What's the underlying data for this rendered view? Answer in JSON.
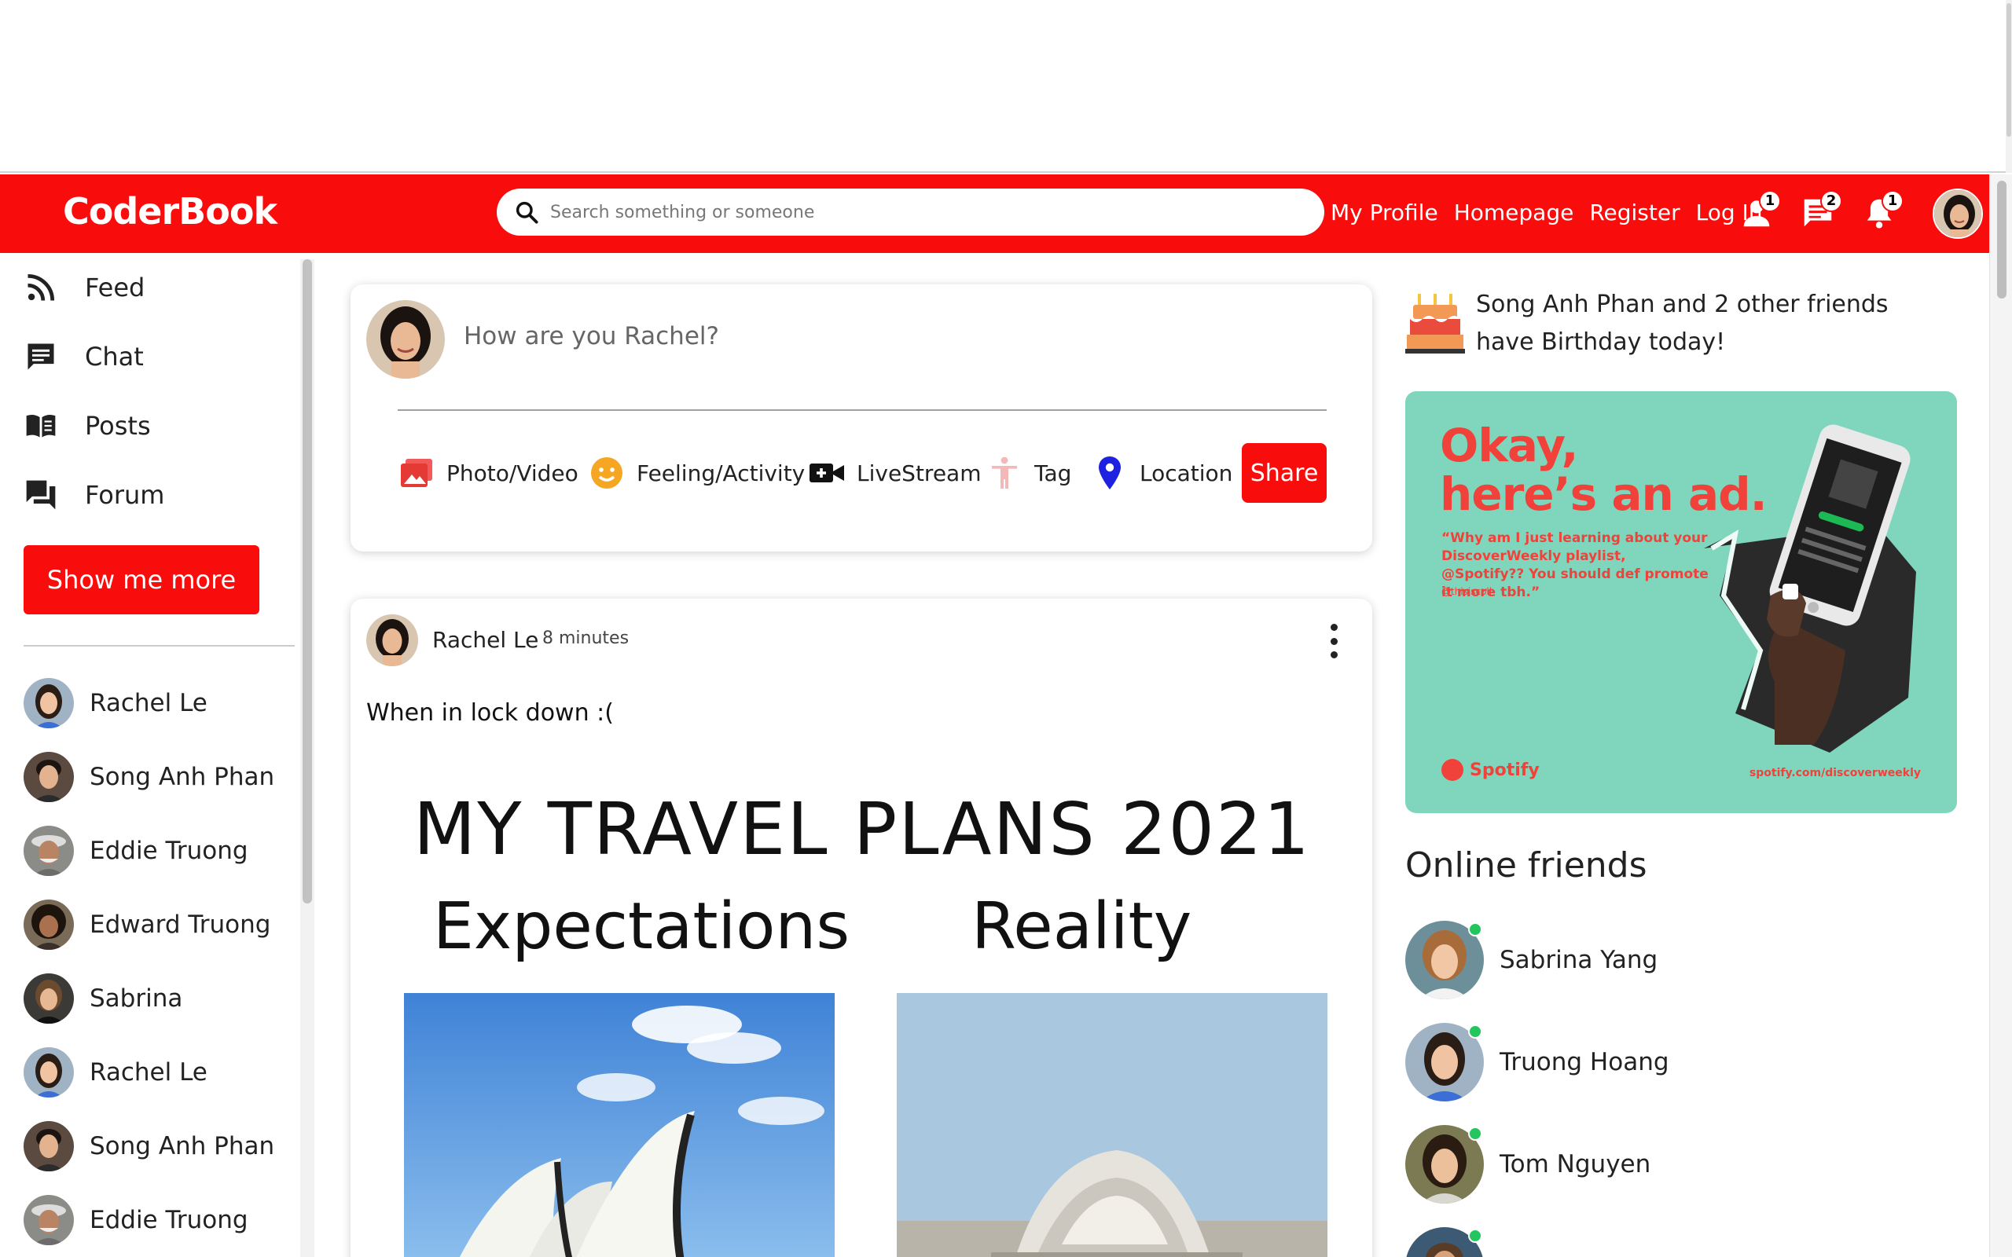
{
  "app": {
    "brand": "CoderBook"
  },
  "search": {
    "placeholder": "Search something or someone"
  },
  "nav": {
    "links": [
      "My Profile",
      "Homepage",
      "Register",
      "Log In"
    ],
    "badges": {
      "friends": "1",
      "messages": "2",
      "notifications": "1"
    },
    "accent_color": "#f80c0c"
  },
  "sidebar": {
    "menu": [
      {
        "label": "Feed",
        "icon": "rss-icon"
      },
      {
        "label": "Chat",
        "icon": "chat-icon"
      },
      {
        "label": "Posts",
        "icon": "book-icon"
      },
      {
        "label": "Forum",
        "icon": "forum-icon"
      }
    ],
    "more_button": "Show me more",
    "friends": [
      "Rachel Le",
      "Song Anh Phan",
      "Eddie Truong",
      "Edward Truong",
      "Sabrina",
      "Rachel Le",
      "Song Anh Phan",
      "Eddie Truong"
    ]
  },
  "composer": {
    "placeholder": "How are you Rachel?",
    "options": [
      "Photo/Video",
      "Feeling/Activity",
      "LiveStream",
      "Tag",
      "Location"
    ],
    "share": "Share"
  },
  "post": {
    "author": "Rachel Le",
    "time": "8 minutes",
    "text": "When in lock down :(",
    "image": {
      "title": "MY TRAVEL PLANS 2021",
      "left": "Expectations",
      "right": "Reality"
    }
  },
  "right": {
    "birthday": "Song Anh Phan and 2 other friends have Birthday today!",
    "ad": {
      "headline_1": "Okay,",
      "headline_2": "here’s an ad.",
      "quote": "“Why am I just learning about your DiscoverWeekly playlist, @Spotify?? You should def promote it more tbh.”",
      "handle": "@thisiscoll",
      "brand": "Spotify",
      "url": "spotify.com/discoverweekly"
    },
    "online_title": "Online friends",
    "online": [
      "Sabrina Yang",
      "Truong Hoang",
      "Tom Nguyen"
    ]
  }
}
